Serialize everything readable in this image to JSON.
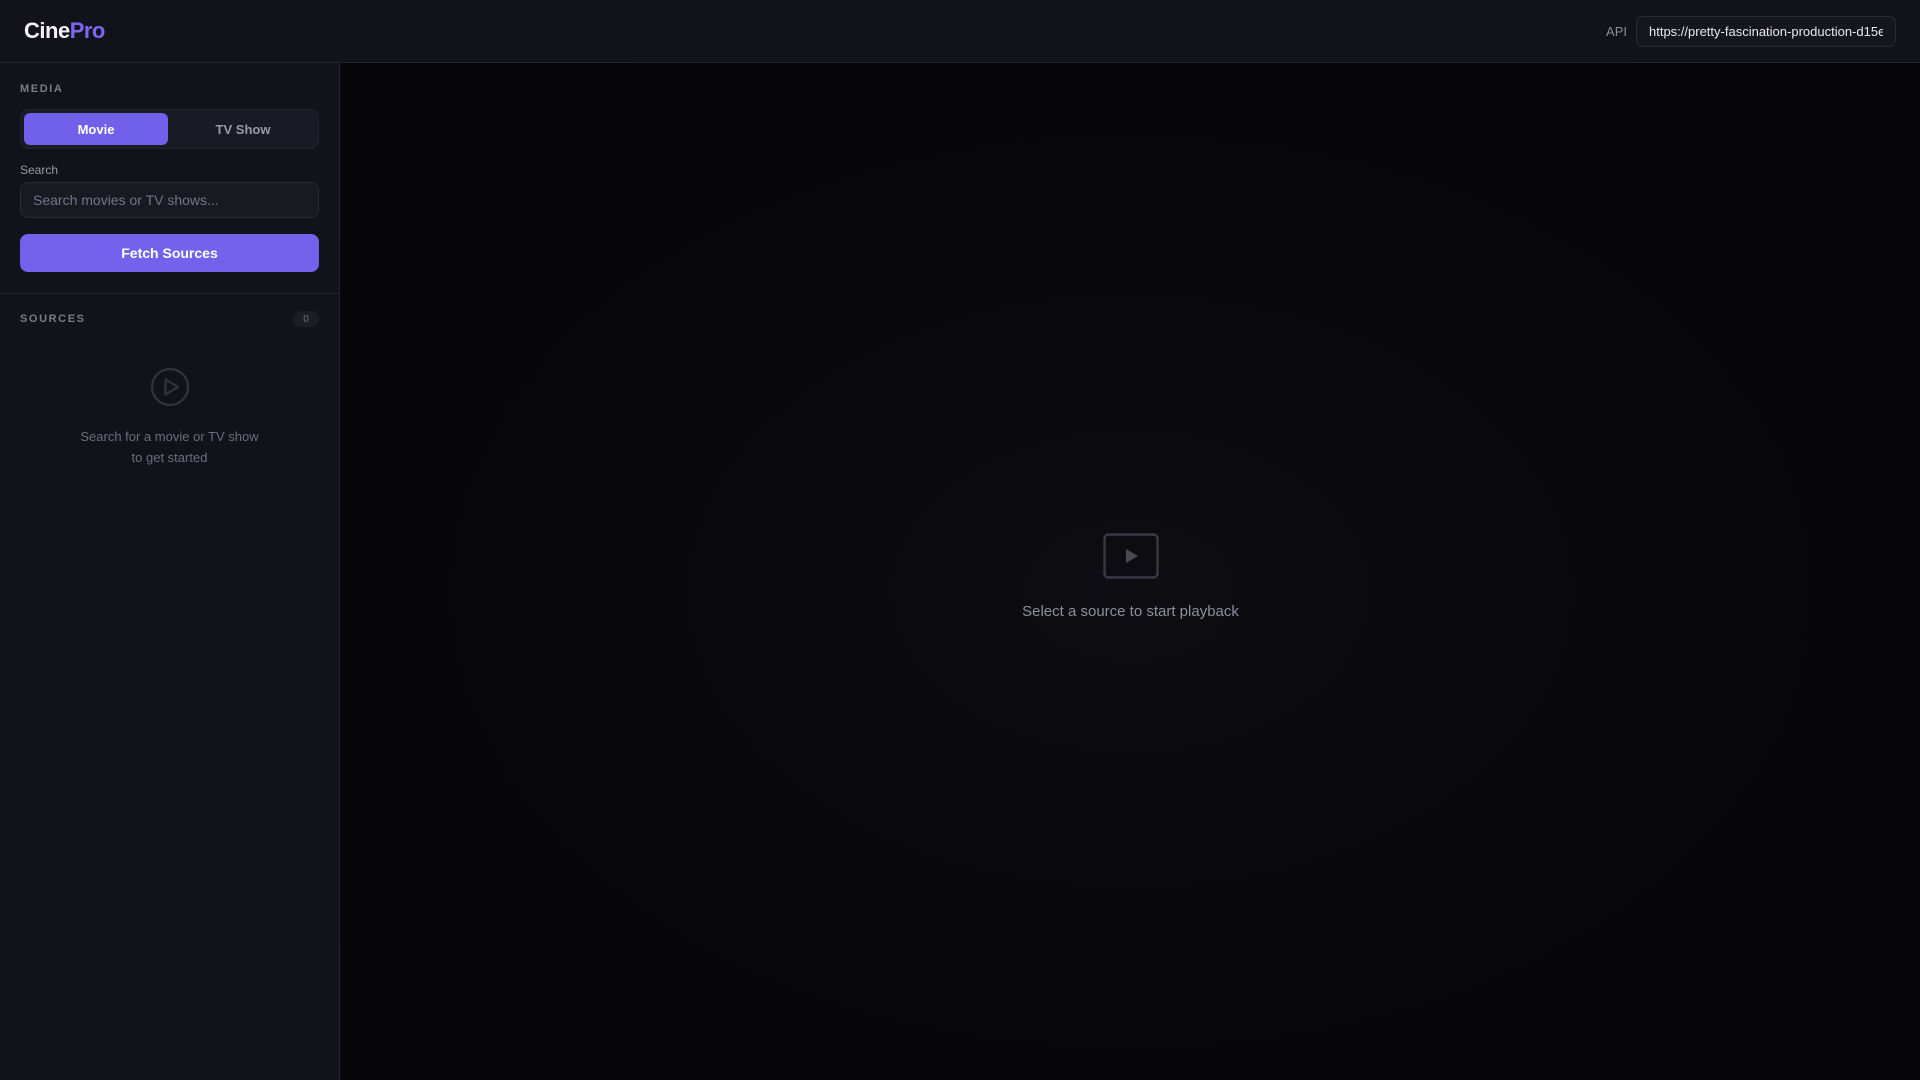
{
  "header": {
    "logo_part1": "Cine",
    "logo_part2": "Pro",
    "api_label": "API",
    "api_url": "https://pretty-fascination-production-d15e"
  },
  "sidebar": {
    "media_title": "MEDIA",
    "tabs": [
      {
        "label": "Movie",
        "active": true
      },
      {
        "label": "TV Show",
        "active": false
      }
    ],
    "search_label": "Search",
    "search_placeholder": "Search movies or TV shows...",
    "fetch_button": "Fetch Sources",
    "sources_title": "SOURCES",
    "sources_count": "0",
    "empty_line1": "Search for a movie or TV show",
    "empty_line2": "to get started",
    "empty_icon": "play-circle-icon"
  },
  "player": {
    "placeholder_icon": "video-play-icon",
    "message": "Select a source to start playback"
  },
  "colors": {
    "accent": "#7462ec",
    "background": "#07070a",
    "panel": "#12121a"
  }
}
